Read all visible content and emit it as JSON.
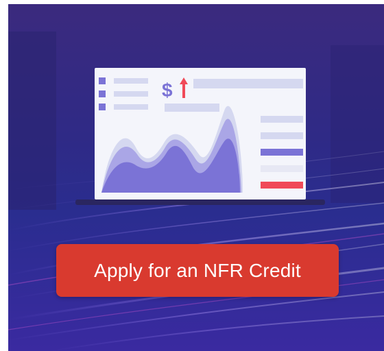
{
  "banner": {
    "cta_label": "Apply for an NFR Credit",
    "dollar_symbol": "$",
    "colors": {
      "background_top": "#3b2a7e",
      "background_bottom": "#3a2aa0",
      "cta_background": "#d93a2f",
      "chart_dark": "#7b73d6",
      "chart_mid": "#aaa6e6",
      "chart_light": "#d5d8f0",
      "up_arrow": "#f04a58"
    },
    "icons": [
      "laptop-illustration",
      "area-chart-icon",
      "dollar-icon",
      "up-arrow-icon"
    ]
  }
}
